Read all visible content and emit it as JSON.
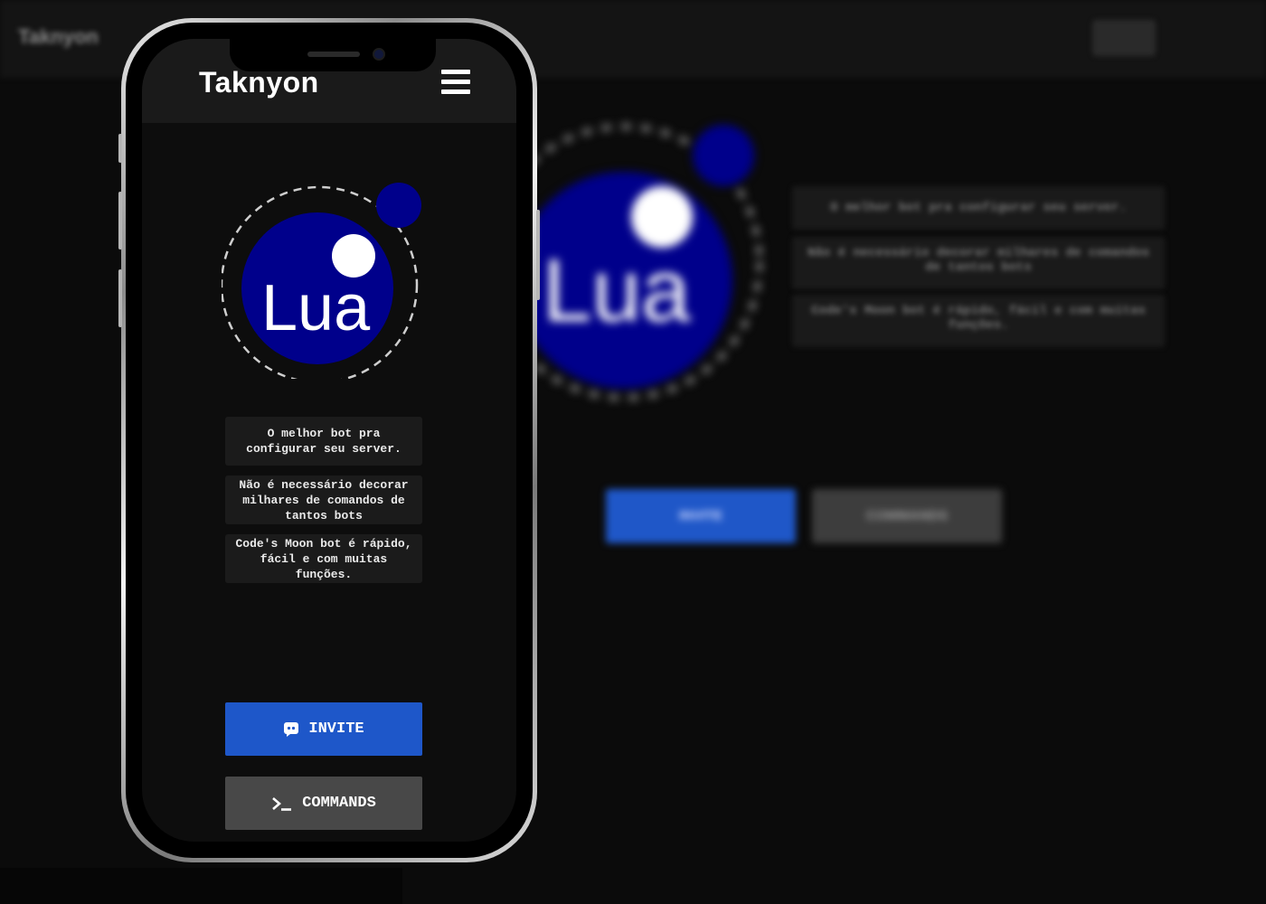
{
  "app": {
    "title": "Taknyon",
    "logo_text": "Lua",
    "menu_icon": "hamburger-menu-icon"
  },
  "descriptions": [
    "O melhor bot pra configurar seu server.",
    "Não é necessário decorar milhares de comandos de tantos bots",
    "Code's Moon bot é rápido, fácil e com muitas funções."
  ],
  "buttons": {
    "invite_label": "INVITE",
    "invite_icon": "discord-icon",
    "commands_label": "COMMANDS",
    "commands_icon": "terminal-prompt-icon"
  },
  "colors": {
    "background": "#0d0d0d",
    "header": "#1a1a1a",
    "logo_blue": "#00008b",
    "invite_blue": "#1e57c9",
    "commands_gray": "#484848"
  }
}
